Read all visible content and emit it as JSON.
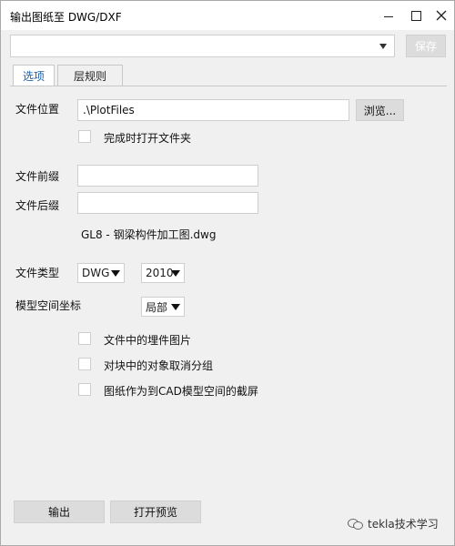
{
  "window": {
    "title": "输出图纸至 DWG/DXF"
  },
  "toolbar": {
    "preset_value": "",
    "save_label": "保存"
  },
  "tabs": [
    {
      "label": "选项",
      "active": true
    },
    {
      "label": "层规则",
      "active": false
    }
  ],
  "options": {
    "file_location_label": "文件位置",
    "file_location_value": ".\\PlotFiles",
    "browse_label": "浏览...",
    "open_folder_label": "完成时打开文件夹",
    "open_folder_checked": false,
    "prefix_label": "文件前缀",
    "prefix_value": "",
    "suffix_label": "文件后缀",
    "suffix_value": "",
    "filename_preview": "GL8 - 钢梁构件加工图.dwg",
    "file_type_label": "文件类型",
    "file_type_value": "DWG",
    "version_value": "2010",
    "model_space_label": "模型空间坐标",
    "model_space_value": "局部",
    "checkbox_1_label": "文件中的埋件图片",
    "checkbox_1_checked": false,
    "checkbox_2_label": "对块中的对象取消分组",
    "checkbox_2_checked": false,
    "checkbox_3_label": "图纸作为到CAD模型空间的截屏",
    "checkbox_3_checked": false
  },
  "footer": {
    "export_label": "输出",
    "preview_label": "打开预览"
  },
  "watermark": {
    "text": "tekla技术学习"
  },
  "icons": {
    "minimize": "minimize-icon",
    "maximize": "maximize-icon",
    "close": "close-icon",
    "dropdown": "chevron-down-icon",
    "wechat": "wechat-icon"
  },
  "colors": {
    "active_tab_text": "#1a5ea8",
    "disabled_button_text": "#ffffff",
    "button_bg": "#dcdcdc",
    "window_bg": "#f0f0f0"
  }
}
